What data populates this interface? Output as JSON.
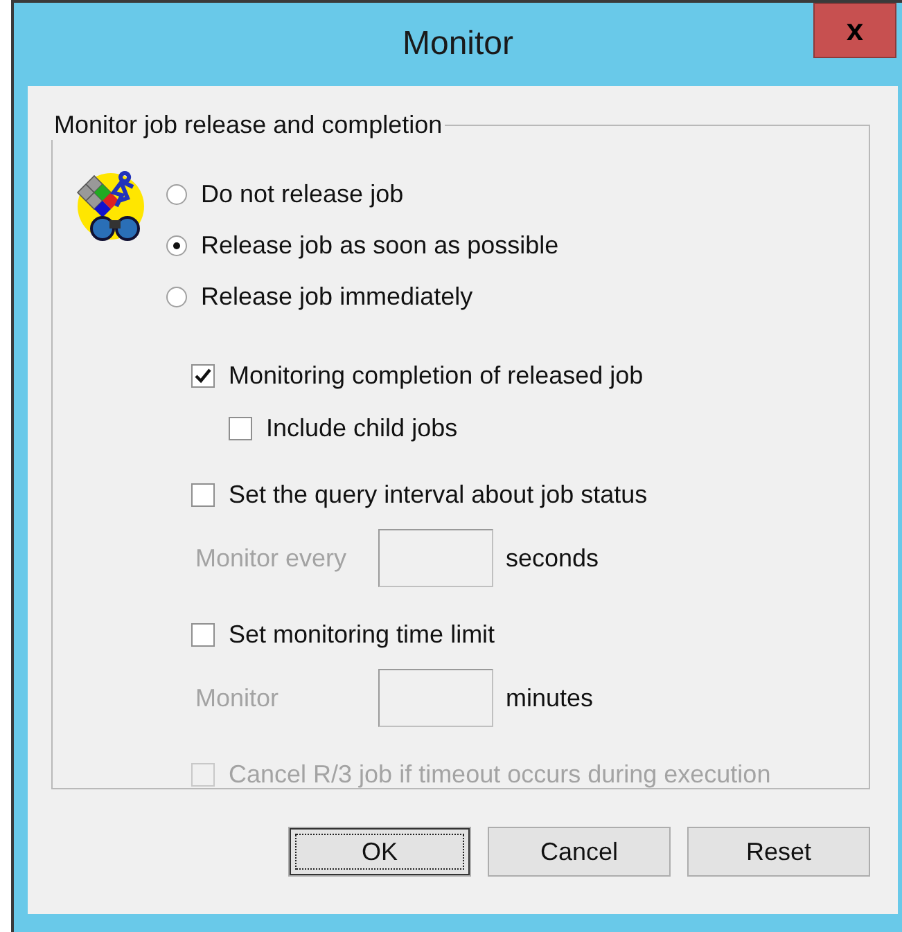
{
  "window": {
    "title": "Monitor",
    "close": "x"
  },
  "group": {
    "label": "Monitor job release and completion"
  },
  "release_options": [
    {
      "label": "Do not release job",
      "selected": false
    },
    {
      "label": "Release job as soon as possible",
      "selected": true
    },
    {
      "label": "Release job immediately",
      "selected": false
    }
  ],
  "options": [
    {
      "kind": "checkbox",
      "label": "Monitoring completion of released job",
      "checked": true,
      "disabled": false,
      "children": [
        {
          "kind": "checkbox",
          "label": "Include child jobs",
          "checked": false,
          "disabled": false
        }
      ]
    },
    {
      "kind": "checkbox",
      "label": "Set the query interval about job status",
      "checked": false,
      "disabled": false
    },
    {
      "kind": "field",
      "label": "Monitor every",
      "unit": "seconds",
      "disabled": true
    },
    {
      "kind": "checkbox",
      "label": "Set monitoring time limit",
      "checked": false,
      "disabled": false
    },
    {
      "kind": "field",
      "label": "Monitor",
      "unit": "minutes",
      "disabled": true
    },
    {
      "kind": "checkbox",
      "label": "Cancel R/3 job if timeout occurs during execution",
      "checked": false,
      "disabled": true
    }
  ],
  "buttons": [
    {
      "label": "OK",
      "focused": true
    },
    {
      "label": "Cancel",
      "focused": false
    },
    {
      "label": "Reset",
      "focused": false
    }
  ]
}
